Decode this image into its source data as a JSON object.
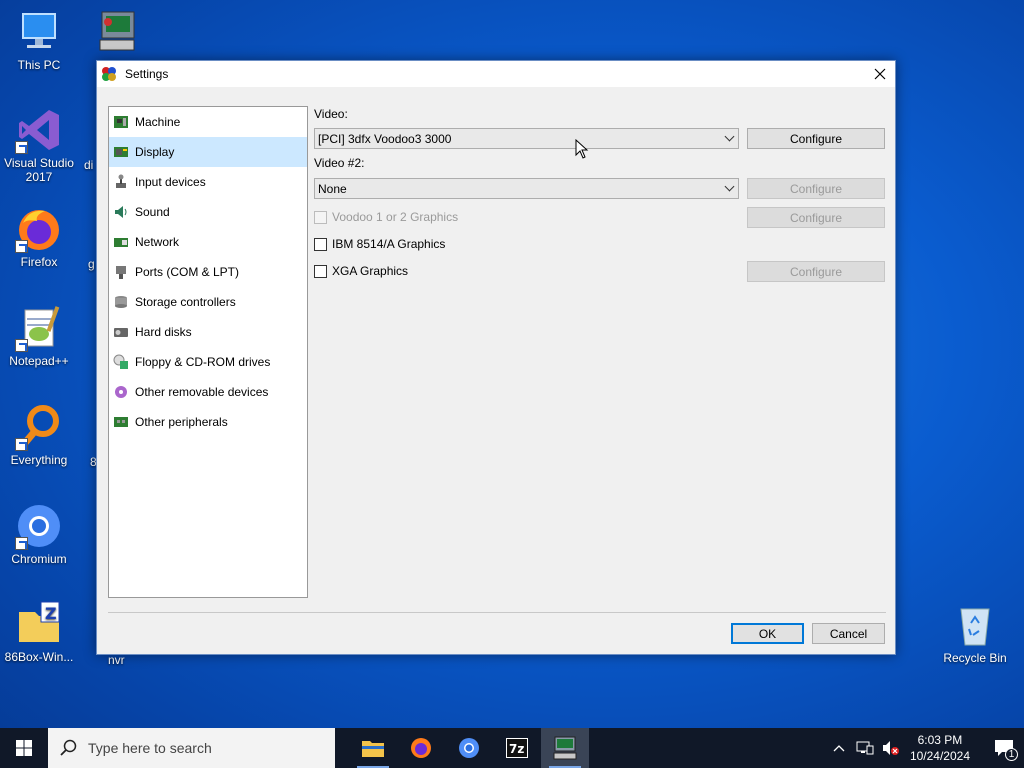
{
  "desktop": {
    "icons": [
      {
        "label": "This PC"
      },
      {
        "label": "Visual Studio 2017"
      },
      {
        "label": "Firefox"
      },
      {
        "label": "Notepad++"
      },
      {
        "label": "Everything"
      },
      {
        "label": "Chromium"
      },
      {
        "label": "86Box-Win..."
      },
      {
        "label": "Recycle Bin"
      }
    ],
    "partial_labels": {
      "di": "di",
      "g": "g",
      "nvr": "nvr",
      "eight": "8"
    }
  },
  "window": {
    "title": "Settings",
    "nav": [
      {
        "label": "Machine"
      },
      {
        "label": "Display",
        "selected": true
      },
      {
        "label": "Input devices"
      },
      {
        "label": "Sound"
      },
      {
        "label": "Network"
      },
      {
        "label": "Ports (COM & LPT)"
      },
      {
        "label": "Storage controllers"
      },
      {
        "label": "Hard disks"
      },
      {
        "label": "Floppy & CD-ROM drives"
      },
      {
        "label": "Other removable devices"
      },
      {
        "label": "Other peripherals"
      }
    ],
    "display": {
      "video_label": "Video:",
      "video_value": "[PCI] 3dfx Voodoo3 3000",
      "video2_label": "Video #2:",
      "video2_value": "None",
      "configure_label": "Configure",
      "voodoo_label": "Voodoo 1 or 2 Graphics",
      "ibm_label": "IBM 8514/A Graphics",
      "xga_label": "XGA Graphics"
    },
    "ok_label": "OK",
    "cancel_label": "Cancel"
  },
  "taskbar": {
    "search_placeholder": "Type here to search",
    "apps": [
      "file-explorer",
      "firefox",
      "chromium",
      "7zip",
      "86box"
    ],
    "clock_time": "6:03 PM",
    "clock_date": "10/24/2024",
    "notification_count": "1"
  }
}
